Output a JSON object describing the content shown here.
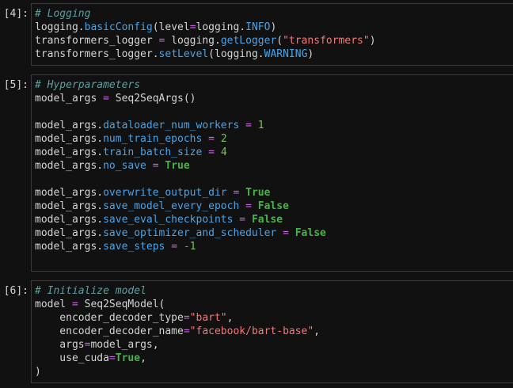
{
  "cells": [
    {
      "prompt": "[4]:",
      "lines": [
        [
          [
            "cm",
            "# Logging"
          ]
        ],
        [
          [
            "tx",
            "logging."
          ],
          [
            "at",
            "basicConfig"
          ],
          [
            "tx",
            "(level"
          ],
          [
            "op",
            "="
          ],
          [
            "tx",
            "logging."
          ],
          [
            "at",
            "INFO"
          ],
          [
            "tx",
            ")"
          ]
        ],
        [
          [
            "tx",
            "transformers_logger "
          ],
          [
            "op",
            "="
          ],
          [
            "tx",
            " logging."
          ],
          [
            "at",
            "getLogger"
          ],
          [
            "tx",
            "("
          ],
          [
            "st",
            "\"transformers\""
          ],
          [
            "tx",
            ")"
          ]
        ],
        [
          [
            "tx",
            "transformers_logger."
          ],
          [
            "at",
            "setLevel"
          ],
          [
            "tx",
            "(logging."
          ],
          [
            "at",
            "WARNING"
          ],
          [
            "tx",
            ")"
          ]
        ]
      ]
    },
    {
      "prompt": "[5]:",
      "lines": [
        [
          [
            "cm",
            "# Hyperparameters"
          ]
        ],
        [
          [
            "tx",
            "model_args "
          ],
          [
            "op",
            "="
          ],
          [
            "tx",
            " Seq2SeqArgs()"
          ]
        ],
        [],
        [
          [
            "tx",
            "model_args."
          ],
          [
            "at",
            "dataloader_num_workers"
          ],
          [
            "tx",
            " "
          ],
          [
            "op",
            "="
          ],
          [
            "tx",
            " "
          ],
          [
            "nm",
            "1"
          ]
        ],
        [
          [
            "tx",
            "model_args."
          ],
          [
            "at",
            "num_train_epochs"
          ],
          [
            "tx",
            " "
          ],
          [
            "op",
            "="
          ],
          [
            "tx",
            " "
          ],
          [
            "nm",
            "2"
          ]
        ],
        [
          [
            "tx",
            "model_args."
          ],
          [
            "at",
            "train_batch_size"
          ],
          [
            "tx",
            " "
          ],
          [
            "op",
            "="
          ],
          [
            "tx",
            " "
          ],
          [
            "nm",
            "4"
          ]
        ],
        [
          [
            "tx",
            "model_args."
          ],
          [
            "at",
            "no_save"
          ],
          [
            "tx",
            " "
          ],
          [
            "op",
            "="
          ],
          [
            "tx",
            " "
          ],
          [
            "kw",
            "True"
          ]
        ],
        [],
        [
          [
            "tx",
            "model_args."
          ],
          [
            "at",
            "overwrite_output_dir"
          ],
          [
            "tx",
            " "
          ],
          [
            "op",
            "="
          ],
          [
            "tx",
            " "
          ],
          [
            "kw",
            "True"
          ]
        ],
        [
          [
            "tx",
            "model_args."
          ],
          [
            "at",
            "save_model_every_epoch"
          ],
          [
            "tx",
            " "
          ],
          [
            "op",
            "="
          ],
          [
            "tx",
            " "
          ],
          [
            "kw",
            "False"
          ]
        ],
        [
          [
            "tx",
            "model_args."
          ],
          [
            "at",
            "save_eval_checkpoints"
          ],
          [
            "tx",
            " "
          ],
          [
            "op",
            "="
          ],
          [
            "tx",
            " "
          ],
          [
            "kw",
            "False"
          ]
        ],
        [
          [
            "tx",
            "model_args."
          ],
          [
            "at",
            "save_optimizer_and_scheduler"
          ],
          [
            "tx",
            " "
          ],
          [
            "op",
            "="
          ],
          [
            "tx",
            " "
          ],
          [
            "kw",
            "False"
          ]
        ],
        [
          [
            "tx",
            "model_args."
          ],
          [
            "at",
            "save_steps"
          ],
          [
            "tx",
            " "
          ],
          [
            "op",
            "="
          ],
          [
            "tx",
            " "
          ],
          [
            "op",
            "-"
          ],
          [
            "nm",
            "1"
          ]
        ],
        []
      ]
    },
    {
      "prompt": "[6]:",
      "lines": [
        [
          [
            "cm",
            "# Initialize model"
          ]
        ],
        [
          [
            "tx",
            "model "
          ],
          [
            "op",
            "="
          ],
          [
            "tx",
            " Seq2SeqModel("
          ]
        ],
        [
          [
            "tx",
            "    encoder_decoder_type"
          ],
          [
            "op",
            "="
          ],
          [
            "st",
            "\"bart\""
          ],
          [
            "tx",
            ","
          ]
        ],
        [
          [
            "tx",
            "    encoder_decoder_name"
          ],
          [
            "op",
            "="
          ],
          [
            "st",
            "\"facebook/bart-base\""
          ],
          [
            "tx",
            ","
          ]
        ],
        [
          [
            "tx",
            "    args"
          ],
          [
            "op",
            "="
          ],
          [
            "tx",
            "model_args,"
          ]
        ],
        [
          [
            "tx",
            "    use_cuda"
          ],
          [
            "op",
            "="
          ],
          [
            "kw",
            "True"
          ],
          [
            "tx",
            ","
          ]
        ],
        [
          [
            "tx",
            ")"
          ]
        ]
      ]
    }
  ]
}
